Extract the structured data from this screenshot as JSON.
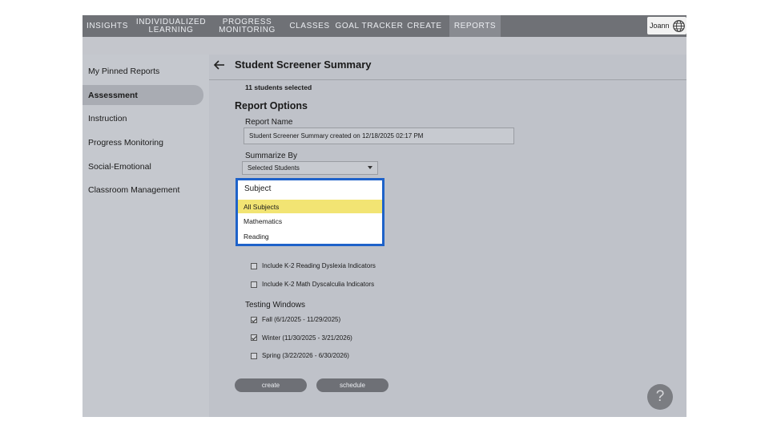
{
  "nav": {
    "items": [
      {
        "label": "INSIGHTS"
      },
      {
        "label1": "INDIVIDUALIZED",
        "label2": "LEARNING"
      },
      {
        "label1": "PROGRESS",
        "label2": "MONITORING"
      },
      {
        "label": "CLASSES"
      },
      {
        "label": "GOAL TRACKER"
      },
      {
        "label": "CREATE"
      },
      {
        "label": "REPORTS"
      }
    ],
    "user_name": "Joann",
    "user_icon": "globe-icon"
  },
  "sidebar": {
    "items": [
      {
        "label": "My Pinned Reports"
      },
      {
        "label": "Assessment"
      },
      {
        "label": "Instruction"
      },
      {
        "label": "Progress Monitoring"
      },
      {
        "label": "Social-Emotional"
      },
      {
        "label": "Classroom Management"
      }
    ],
    "active": "Assessment"
  },
  "main": {
    "title": "Student Screener Summary",
    "selected_count": "11 students selected",
    "report_options_title": "Report Options",
    "report_name_label": "Report Name",
    "report_name_value": "Student Screener Summary created on 12/18/2025 02:17 PM",
    "summarize_label": "Summarize By",
    "summarize_value": "Selected Students",
    "dropdown": {
      "header": "Subject",
      "options": [
        "All Subjects",
        "Mathematics",
        "Reading"
      ],
      "highlighted": "All Subjects"
    },
    "indicators": [
      {
        "label": "Include K-2 Reading Dyslexia Indicators",
        "checked": false
      },
      {
        "label": "Include K-2 Math Dyscalculia Indicators",
        "checked": false
      }
    ],
    "testing_windows_label": "Testing Windows",
    "testing_windows": [
      {
        "label": "Fall (6/1/2025 - 11/29/2025)",
        "checked": true
      },
      {
        "label": "Winter (11/30/2025 - 3/21/2026)",
        "checked": true
      },
      {
        "label": "Spring (3/22/2026 - 6/30/2026)",
        "checked": false
      }
    ],
    "create_label": "create",
    "schedule_label": "schedule",
    "help_label": "?"
  },
  "colors": {
    "nav_bg": "#6f7176",
    "active_tab": "#898b91",
    "app_bg": "#bfc2c9",
    "dropdown_border": "#1e62c9",
    "highlight": "#f2e473"
  }
}
